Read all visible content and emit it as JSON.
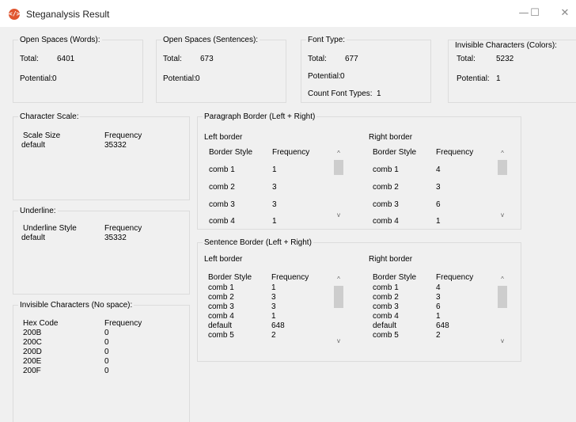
{
  "window": {
    "title": "Steganalysis Result",
    "icon": "code-icon",
    "minimize_glyph": "—",
    "maximize_glyph": "☐",
    "close_glyph": "✕"
  },
  "open_words": {
    "title": "Open Spaces (Words):",
    "total_label": "Total:",
    "total_value": "6401",
    "potential_label": "Potential:",
    "potential_value": "0"
  },
  "open_sentences": {
    "title": "Open Spaces (Sentences):",
    "total_label": "Total:",
    "total_value": "673",
    "potential_label": "Potential:",
    "potential_value": "0"
  },
  "font_type": {
    "title": "Font Type:",
    "total_label": "Total:",
    "total_value": "677",
    "potential_label": "Potential:",
    "potential_value": "0",
    "count_label": "Count Font Types:",
    "count_value": "1"
  },
  "invisible_colors": {
    "title": "Invisible Characters (Colors):",
    "total_label": "Total:",
    "total_value": "5232",
    "potential_label": "Potential:",
    "potential_value": "1"
  },
  "char_scale": {
    "title": "Character Scale:",
    "headers": [
      "Scale Size",
      "Frequency"
    ],
    "rows": [
      [
        "default",
        "35332"
      ]
    ]
  },
  "underline": {
    "title": "Underline:",
    "headers": [
      "Underline Style",
      "Frequency"
    ],
    "rows": [
      [
        "default",
        "35332"
      ]
    ]
  },
  "invisible_nospace": {
    "title": "Invisible Characters (No space):",
    "headers": [
      "Hex Code",
      "Frequency"
    ],
    "rows": [
      [
        "200B",
        "0"
      ],
      [
        "200C",
        "0"
      ],
      [
        "200D",
        "0"
      ],
      [
        "200E",
        "0"
      ],
      [
        "200F",
        "0"
      ]
    ]
  },
  "paragraph_border": {
    "title": "Paragraph Border (Left + Right)",
    "left": {
      "label": "Left border",
      "headers": [
        "Border Style",
        "Frequency"
      ],
      "rows": [
        [
          "comb 1",
          "1"
        ],
        [
          "comb 2",
          "3"
        ],
        [
          "comb 3",
          "3"
        ],
        [
          "comb 4",
          "1"
        ]
      ]
    },
    "right": {
      "label": "Right border",
      "headers": [
        "Border Style",
        "Frequency"
      ],
      "rows": [
        [
          "comb 1",
          "4"
        ],
        [
          "comb 2",
          "3"
        ],
        [
          "comb 3",
          "6"
        ],
        [
          "comb 4",
          "1"
        ]
      ]
    }
  },
  "sentence_border": {
    "title": "Sentence Border (Left + Right)",
    "left": {
      "label": "Left border",
      "headers": [
        "Border Style",
        "Frequency"
      ],
      "rows": [
        [
          "comb 1",
          "1"
        ],
        [
          "comb 2",
          "3"
        ],
        [
          "comb 3",
          "3"
        ],
        [
          "comb 4",
          "1"
        ],
        [
          "default",
          "648"
        ],
        [
          "comb 5",
          "2"
        ]
      ]
    },
    "right": {
      "label": "Right border",
      "headers": [
        "Border Style",
        "Frequency"
      ],
      "rows": [
        [
          "comb 1",
          "4"
        ],
        [
          "comb 2",
          "3"
        ],
        [
          "comb 3",
          "6"
        ],
        [
          "comb 4",
          "1"
        ],
        [
          "default",
          "648"
        ],
        [
          "comb 5",
          "2"
        ]
      ]
    }
  },
  "scroll": {
    "up_glyph": "^",
    "down_glyph": "v"
  }
}
